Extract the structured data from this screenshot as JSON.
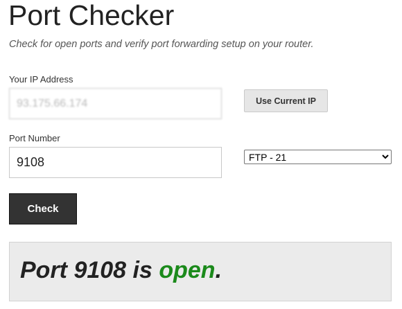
{
  "page": {
    "title": "Port Checker",
    "subtitle": "Check for open ports and verify port forwarding setup on your router."
  },
  "ip_field": {
    "label": "Your IP Address",
    "value": "93.175.66.174"
  },
  "use_ip_button": {
    "label": "Use Current IP"
  },
  "port_field": {
    "label": "Port Number",
    "value": "9108"
  },
  "port_select": {
    "selected": "FTP - 21",
    "options": [
      "FTP - 21"
    ]
  },
  "check_button": {
    "label": "Check"
  },
  "result": {
    "prefix": "Port 9108 is ",
    "status": "open",
    "suffix": ".",
    "status_color": "#1b8a1b"
  },
  "colors": {
    "check_button_bg": "#333333",
    "result_box_bg": "#ebebeb"
  }
}
